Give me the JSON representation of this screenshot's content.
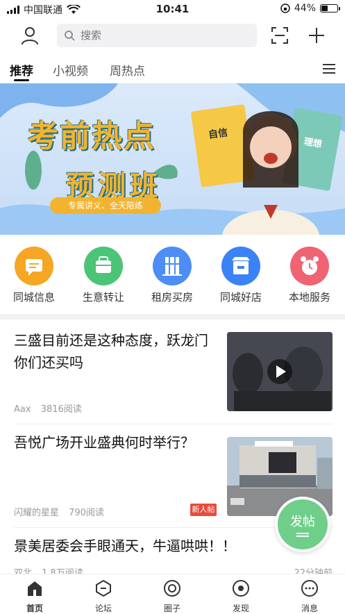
{
  "status_bar": {
    "carrier": "中国联通",
    "time": "10:41",
    "battery": "44%",
    "battery_level": 0.44
  },
  "search": {
    "placeholder": "搜索"
  },
  "tabs": [
    {
      "label": "推荐",
      "active": true
    },
    {
      "label": "小视频"
    },
    {
      "label": "周热点"
    }
  ],
  "banner": {
    "title": "考前热点",
    "subtitle": "预测班",
    "tagline": "专属讲义、全天陪练",
    "book_left": "自信",
    "book_right": "理想"
  },
  "quick_links": [
    {
      "label": "同城信息",
      "icon": "chat-icon",
      "color": "#f5a623"
    },
    {
      "label": "生意转让",
      "icon": "shop-bag-icon",
      "color": "#4cc478"
    },
    {
      "label": "租房买房",
      "icon": "building-icon",
      "color": "#4c8df6"
    },
    {
      "label": "同城好店",
      "icon": "store-icon",
      "color": "#3b82f6"
    },
    {
      "label": "本地服务",
      "icon": "alarm-icon",
      "color": "#f06373"
    }
  ],
  "news": [
    {
      "title": "三盛目前还是这种态度，跃龙门你们还买吗",
      "author": "Aax",
      "reads": "3816阅读"
    },
    {
      "title": "吾悦广场开业盛典何时举行？",
      "author": "闪耀的星星",
      "reads": "790阅读",
      "badge": "新人帖"
    },
    {
      "title": "景美居委会手眼通天，牛逼哄哄！！",
      "author": "双北",
      "reads": "1.8万阅读",
      "time": "22分钟前"
    }
  ],
  "fab": {
    "label": "发帖"
  },
  "bottom_nav": [
    {
      "label": "首页",
      "active": true
    },
    {
      "label": "论坛"
    },
    {
      "label": "圈子"
    },
    {
      "label": "发现"
    },
    {
      "label": "消息"
    }
  ]
}
